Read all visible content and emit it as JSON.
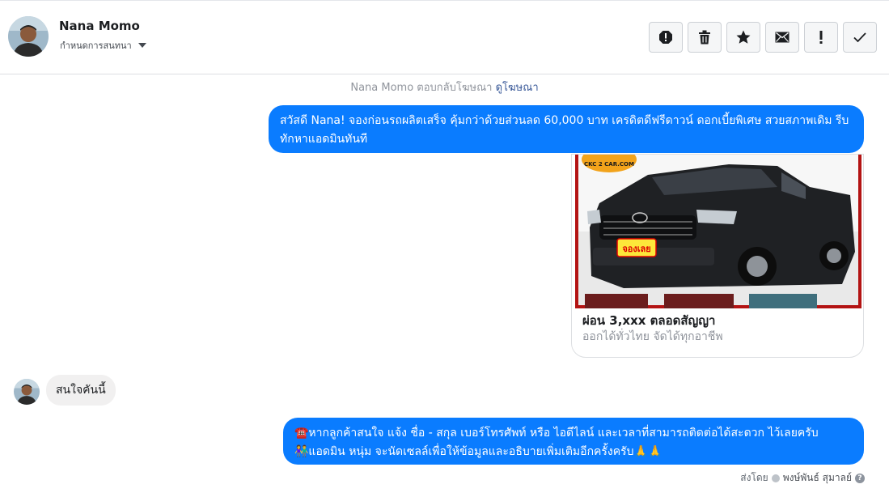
{
  "header": {
    "contact_name": "Nana Momo",
    "assign_label": "กำหนดการสนทนา",
    "actions": [
      {
        "icon": "report-icon",
        "label": "!"
      },
      {
        "icon": "trash-icon",
        "label": ""
      },
      {
        "icon": "star-icon",
        "label": ""
      },
      {
        "icon": "envelope-icon",
        "label": ""
      },
      {
        "icon": "exclamation-icon",
        "label": "!"
      },
      {
        "icon": "checkmark-icon",
        "label": ""
      }
    ]
  },
  "conversation": {
    "ad_note_prefix": "Nana Momo ตอบกลับโฆษณา",
    "ad_note_link": "ดูโฆษณา",
    "message1": "สวัสดี Nana! จองก่อนรถผลิตเสร็จ คุ้มกว่าด้วยส่วนลด 60,000 บาท เครดิตดีฟรีดาวน์ ดอกเบี้ยพิเศษ สวยสภาพเดิม รีบทักหาแอดมินทันที",
    "card": {
      "title": "ผ่อน 3,xxx ตลอดสัญญา",
      "subtitle": "ออกได้ทั่วไทย จัดได้ทุกอาชีพ",
      "image_logo_text": "CKC 2 CAR.COM",
      "image_sticker_text": "จองเลย"
    },
    "reply": "สนใจคันนี้",
    "message2_line1": "☎️หากลูกค้าสนใจ แจ้ง ชื่อ - สกุล เบอร์โทรศัพท์ หรือ ไอดีไลน์ และเวลาที่สามารถติดต่อได้สะดวก ไว้เลยครับ",
    "message2_line2": "👫แอดมิน หนุ่ม จะนัดเซลล์เพื่อให้ข้อมูลและอธิบายเพิ่มเติมอีกครั้งครับ🙏🙏",
    "sent_by_label": "ส่งโดย",
    "sent_by_name": "พงษ์พันธ์ สุมาลย์"
  },
  "colors": {
    "outgoing_bubble": "#0a7cff",
    "incoming_bubble": "#f1f0f0",
    "link": "#385898"
  }
}
